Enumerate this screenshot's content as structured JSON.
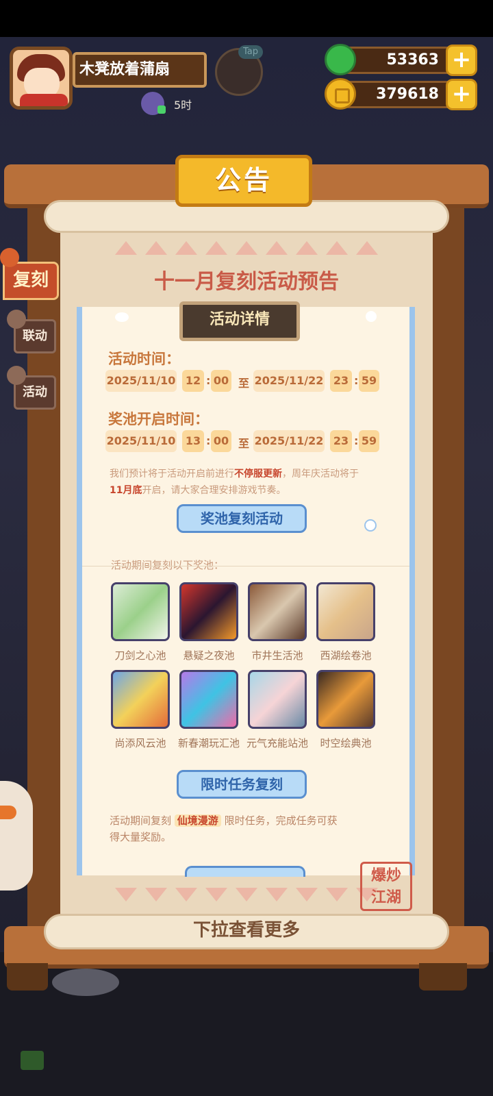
{
  "player": {
    "name": "木凳放着蒲扇",
    "energy_time": "5时",
    "tap_label": "Tap"
  },
  "currencies": {
    "jade": "53363",
    "coins": "379618",
    "plus": "+"
  },
  "board": {
    "title": "公告",
    "heading": "十一月复刻活动预告",
    "footer": "下拉查看更多",
    "stamp_line1": "爆炒",
    "stamp_line2": "江湖"
  },
  "tabs": [
    "复刻",
    "联动",
    "活动"
  ],
  "card": {
    "header": "活动详情",
    "event_time_label": "活动时间：",
    "event_time": {
      "start_date": "2025/11/10",
      "start_h": "12",
      "start_m": "00",
      "sep": "至",
      "end_date": "2025/11/22",
      "end_h": "23",
      "end_m": "59"
    },
    "pool_time_label": "奖池开启时间：",
    "pool_time": {
      "start_date": "2025/11/10",
      "start_h": "13",
      "start_m": "00",
      "sep": "至",
      "end_date": "2025/11/22",
      "end_h": "23",
      "end_m": "59"
    },
    "colon": ":",
    "notice_p1": "我们预计将于活动开启前进行",
    "notice_bold1": "不停服更新",
    "notice_p2": "，周年庆活动将于",
    "notice_bold2": "11月底",
    "notice_p3": "开启，请大家合理安排游戏节奏。",
    "pool_button": "奖池复刻活动",
    "pool_intro": "活动期间复刻以下奖池：",
    "pools": [
      "刀剑之心池",
      "悬疑之夜池",
      "市井生活池",
      "西湖绘卷池",
      "尚添风云池",
      "新春潮玩汇池",
      "元气充能站池",
      "时空绘典池"
    ],
    "task_button": "限时任务复刻",
    "task_p1": "活动期间复刻",
    "task_highlight": "仙境漫游",
    "task_p2": "限时任务，完成任务可获",
    "task_p3": "得大量奖励。"
  }
}
